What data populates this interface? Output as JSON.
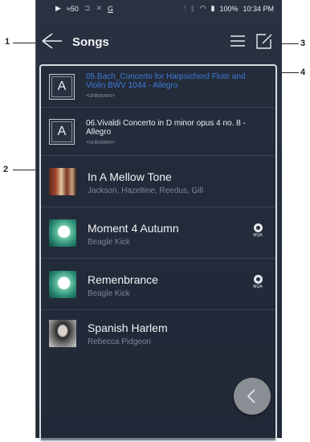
{
  "status": {
    "left_icons": [
      "play-icon",
      "signal-icon",
      "cast-icon",
      "shuffle-icon",
      "g-icon"
    ],
    "volume": "50",
    "battery": "100%",
    "time": "10:34 PM"
  },
  "header": {
    "title": "Songs"
  },
  "tracks": [
    {
      "title": "05.Bach_Concerto for Harpsichord Flute and Violin BWV 1044 - Allegro",
      "subtitle": "<unknown>",
      "active": true
    },
    {
      "title": "06.Vivaldi Concerto in D minor opus 4 no. 8 - Allegro",
      "subtitle": "<unknown>",
      "active": false
    },
    {
      "title": "In A Mellow Tone",
      "subtitle": "Jackson, Hazeltine, Reedus, Gill",
      "mqa": false
    },
    {
      "title": "Moment 4 Autumn",
      "subtitle": "Beagle Kick",
      "mqa": true
    },
    {
      "title": "Remenbrance",
      "subtitle": "Beagle Kick",
      "mqa": true
    },
    {
      "title": "Spanish Harlem",
      "subtitle": "Rebecca Pidgeon",
      "mqa": false
    }
  ],
  "mqa_label": "MQA",
  "callouts": {
    "c1": "1",
    "c2": "2",
    "c3": "3",
    "c4": "4"
  },
  "colors": {
    "accent": "#3f7bd9",
    "panel_border": "#d8dbe0"
  }
}
